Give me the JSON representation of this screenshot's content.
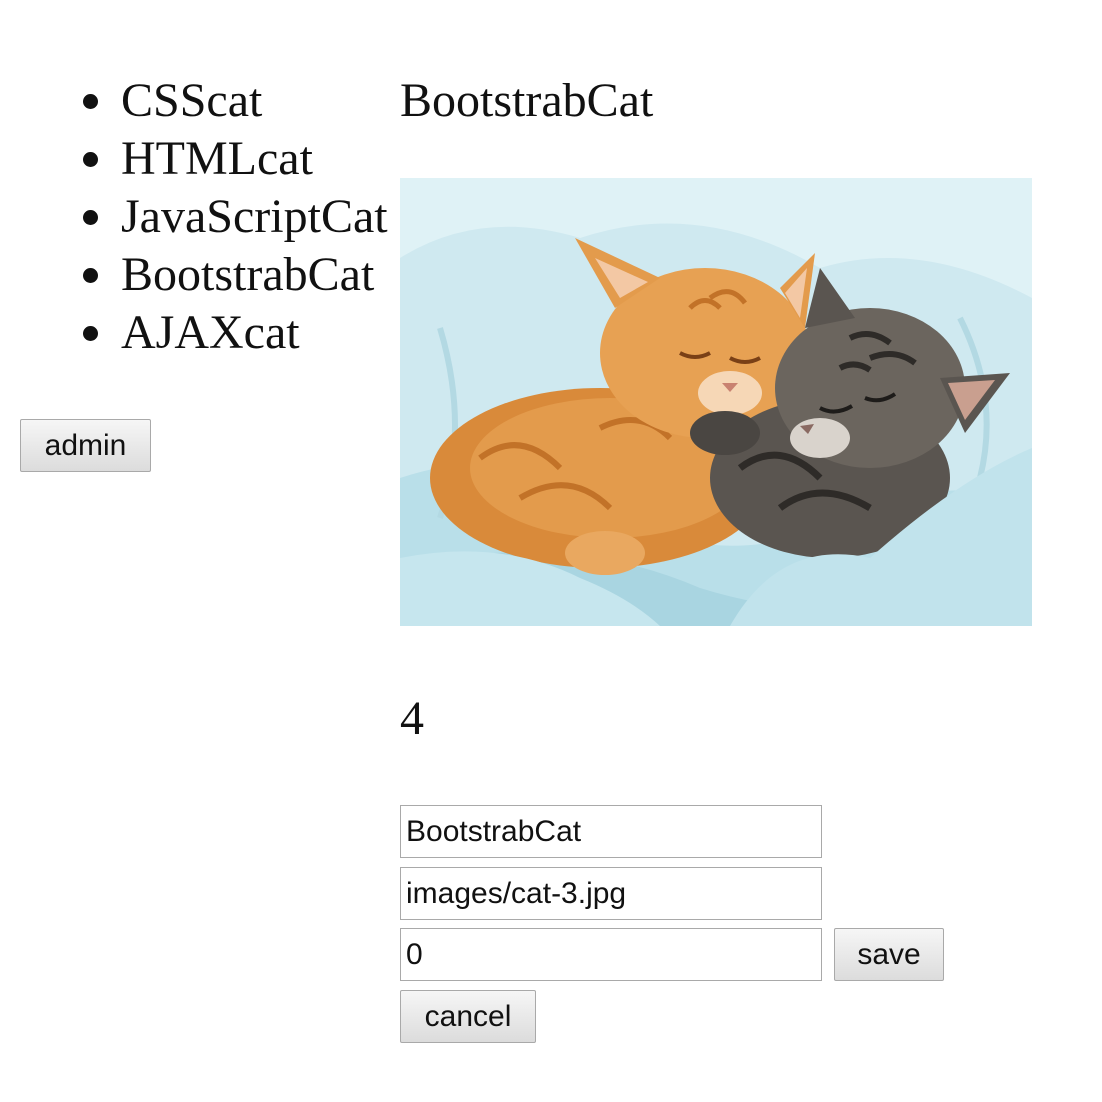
{
  "cat_list": {
    "items": [
      {
        "label": "CSScat"
      },
      {
        "label": "HTMLcat"
      },
      {
        "label": "JavaScriptCat"
      },
      {
        "label": "BootstrabCat"
      },
      {
        "label": "AJAXcat"
      }
    ]
  },
  "admin": {
    "button_label": "admin"
  },
  "selected_cat": {
    "name": "BootstrabCat",
    "image_description": "two kittens (orange tabby and grey tabby) sleeping cuddled on a light blue blanket",
    "click_count": "4"
  },
  "admin_form": {
    "name_value": "BootstrabCat",
    "image_value": "images/cat-3.jpg",
    "clicks_value": "0",
    "save_label": "save",
    "cancel_label": "cancel"
  },
  "colors": {
    "blanket": "#c6e6ee",
    "orange_kitten": "#d98a3a",
    "grey_kitten": "#5a5550",
    "button_face": "#e6e6e6"
  }
}
